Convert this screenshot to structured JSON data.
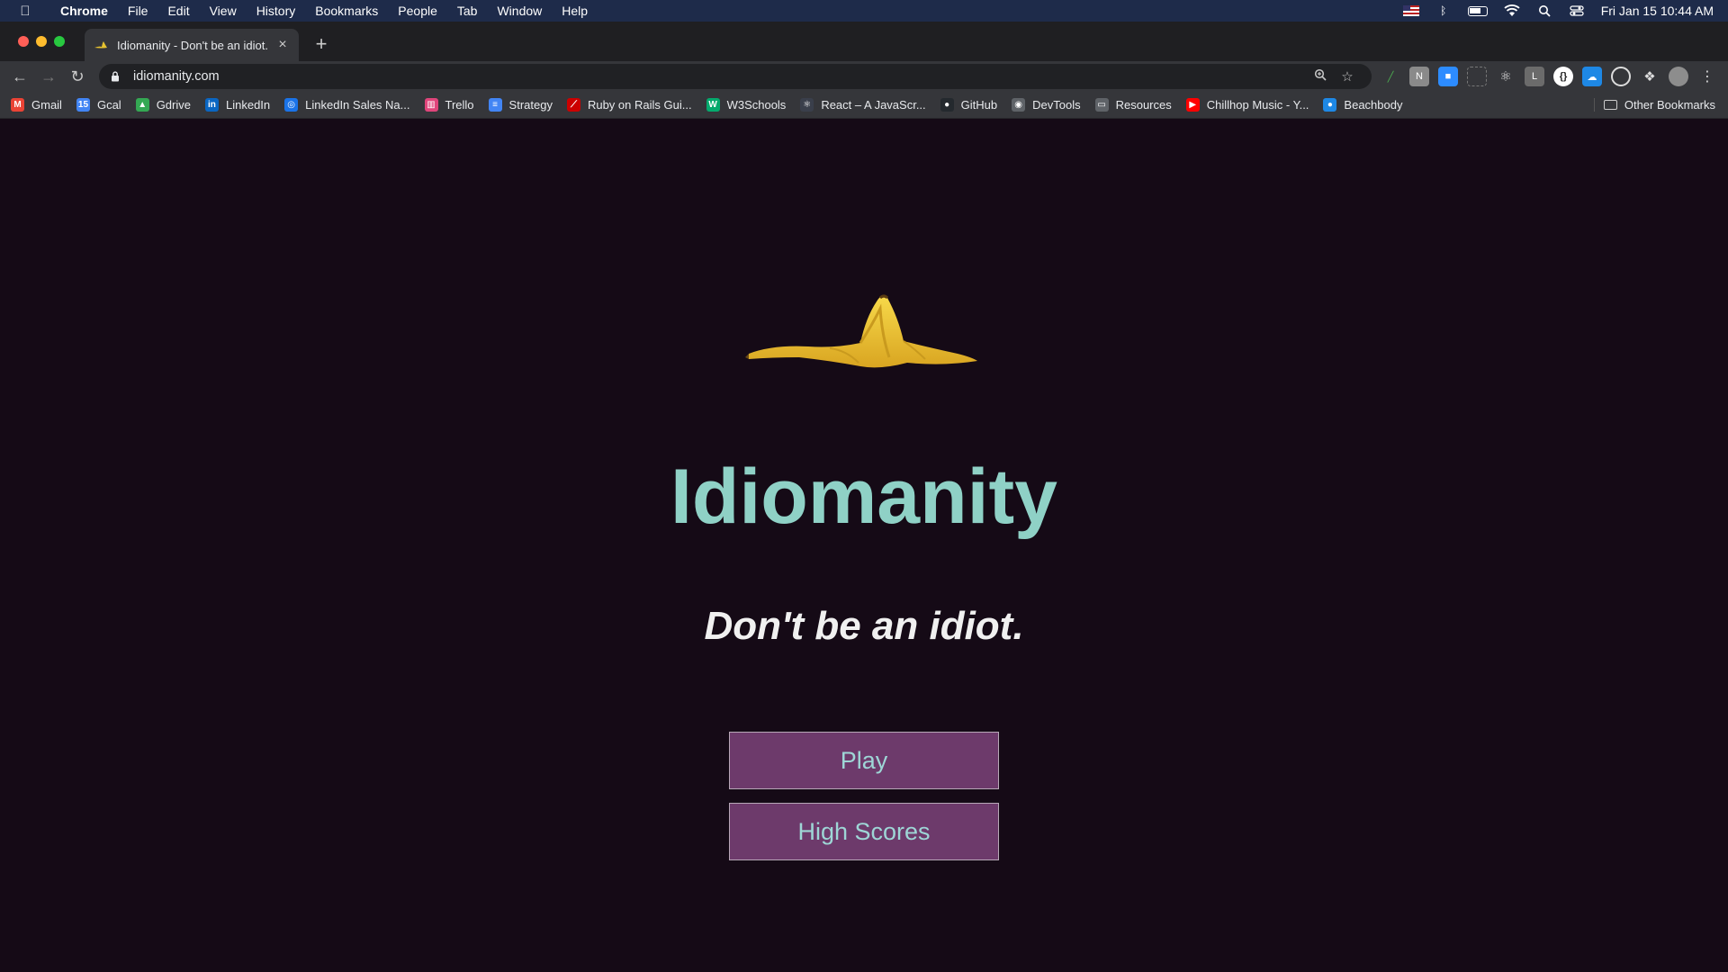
{
  "menubar": {
    "app_name": "Chrome",
    "items": [
      "File",
      "Edit",
      "View",
      "History",
      "Bookmarks",
      "People",
      "Tab",
      "Window",
      "Help"
    ],
    "clock": "Fri Jan 15  10:44 AM"
  },
  "tab": {
    "title": "Idiomanity - Don't be an idiot."
  },
  "omnibox": {
    "url": "idiomanity.com"
  },
  "bookmarks": {
    "items": [
      {
        "label": "Gmail",
        "icon": "gmail-icon",
        "color": "#ea4335",
        "glyph": "M"
      },
      {
        "label": "Gcal",
        "icon": "calendar-icon",
        "color": "#4285f4",
        "glyph": "15"
      },
      {
        "label": "Gdrive",
        "icon": "drive-icon",
        "color": "#34a853",
        "glyph": "▲"
      },
      {
        "label": "LinkedIn",
        "icon": "linkedin-icon",
        "color": "#0a66c2",
        "glyph": "in"
      },
      {
        "label": "LinkedIn Sales Na...",
        "icon": "compass-icon",
        "color": "#1a73e8",
        "glyph": "◎"
      },
      {
        "label": "Trello",
        "icon": "trello-icon",
        "color": "#e0457b",
        "glyph": "▥"
      },
      {
        "label": "Strategy",
        "icon": "docs-icon",
        "color": "#4285f4",
        "glyph": "≡"
      },
      {
        "label": "Ruby on Rails Gui...",
        "icon": "rails-icon",
        "color": "#cc0000",
        "glyph": "⟋"
      },
      {
        "label": "W3Schools",
        "icon": "w3schools-icon",
        "color": "#04aa6d",
        "glyph": "W"
      },
      {
        "label": "React – A JavaScr...",
        "icon": "react-icon",
        "color": "#3a3f4b",
        "glyph": "⚛"
      },
      {
        "label": "GitHub",
        "icon": "github-icon",
        "color": "#24292e",
        "glyph": "●"
      },
      {
        "label": "DevTools",
        "icon": "globe-icon",
        "color": "#5f6368",
        "glyph": "◉"
      },
      {
        "label": "Resources",
        "icon": "folder-icon",
        "color": "#5f6368",
        "glyph": "▭"
      },
      {
        "label": "Chillhop Music - Y...",
        "icon": "youtube-icon",
        "color": "#ff0000",
        "glyph": "▶"
      },
      {
        "label": "Beachbody",
        "icon": "beachbody-icon",
        "color": "#1e88e5",
        "glyph": "●"
      }
    ],
    "other": "Other Bookmarks"
  },
  "page": {
    "logo_icon": "banana-peel-icon",
    "title": "Idiomanity",
    "tagline": "Don't be an idiot.",
    "buttons": {
      "play": "Play",
      "high_scores": "High Scores"
    }
  },
  "colors": {
    "background": "#150a16",
    "title": "#8fd1c6",
    "button_bg": "#6d3a6b",
    "button_text": "#9ed6d6"
  }
}
